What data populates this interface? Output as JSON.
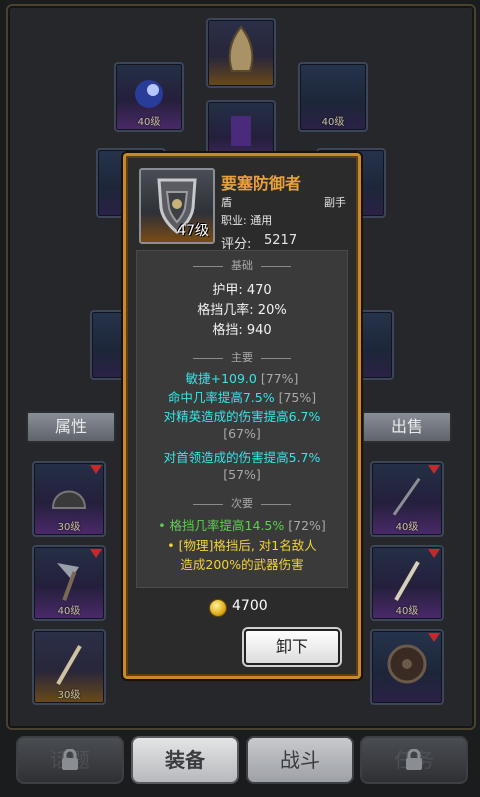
{
  "side_buttons": {
    "attributes": "属性",
    "sell": "出售"
  },
  "tooltip": {
    "name": "要塞防御者",
    "type": "盾",
    "slot": "副手",
    "class_line": "职业: 通用",
    "score_label": "评分:",
    "score_value": "5217",
    "level_badge": "47级",
    "sections": {
      "basic": "基础",
      "main": "主要",
      "secondary": "次要"
    },
    "basic_stats": [
      "护甲: 470",
      "格挡几率: 20%",
      "格挡: 940"
    ],
    "main_stats": [
      {
        "text": "敏捷+109.0",
        "range": "[77%]"
      },
      {
        "text": "命中几率提高7.5%",
        "range": "[75%]"
      },
      {
        "text": "对精英造成的伤害提高6.7%",
        "range": ""
      },
      {
        "text": "",
        "range": "[67%]"
      },
      {
        "text": "对首领造成的伤害提高5.7%",
        "range": ""
      },
      {
        "text": "",
        "range": "[57%]"
      }
    ],
    "secondary_stats": [
      {
        "text": "• 格挡几率提高14.5%",
        "range": "[72%]",
        "color": "#5ad24a"
      },
      {
        "text": "• [物理]格挡后, 对1名敌人",
        "range": "",
        "color": "#f2d23a"
      },
      {
        "text": "造成200%的武器伤害",
        "range": "",
        "color": "#f2d23a"
      }
    ],
    "price": "4700",
    "unequip_label": "卸下"
  },
  "slots": {
    "inv_level": "40级",
    "levels": [
      "40级",
      "40级",
      "40级",
      "40级",
      "30级",
      "40级",
      "30级",
      "40级"
    ]
  },
  "bottom_tabs": [
    {
      "label": "话题",
      "state": "locked"
    },
    {
      "label": "装备",
      "state": "active"
    },
    {
      "label": "战斗",
      "state": "normal"
    },
    {
      "label": "任务",
      "state": "locked"
    }
  ],
  "colors": {
    "accent": "#c68a2a",
    "main_stat": "#35e6e6",
    "title": "#e8a23a"
  }
}
